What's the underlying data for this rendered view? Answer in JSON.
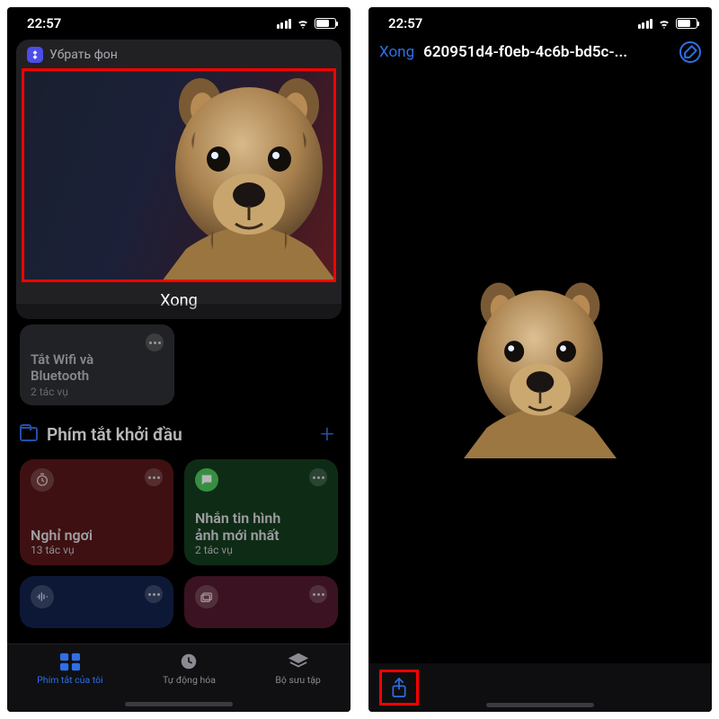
{
  "status": {
    "time": "22:57"
  },
  "left": {
    "overlay": {
      "app_label": "Убрать фон",
      "done": "Xong"
    },
    "wifi_tile": {
      "line1": "Tắt Wifi và",
      "line2": "Bluetooth",
      "sub": "2 tác vụ"
    },
    "section": {
      "title": "Phím tắt khởi đầu"
    },
    "tiles": {
      "rest": {
        "title": "Nghỉ ngơi",
        "sub": "13 tác vụ"
      },
      "msg": {
        "line1": "Nhắn tin hình",
        "line2": "ảnh mới nhất",
        "sub": "2 tác vụ"
      }
    },
    "tabs": {
      "my": "Phím tắt của tôi",
      "auto": "Tự động hóa",
      "gallery": "Bộ sưu tập"
    }
  },
  "right": {
    "done": "Xong",
    "filename": "620951d4-f0eb-4c6b-bd5c-...",
    "markup_glyph": "✎"
  },
  "colors": {
    "accent": "#2e6fe8",
    "highlight": "#f00"
  }
}
